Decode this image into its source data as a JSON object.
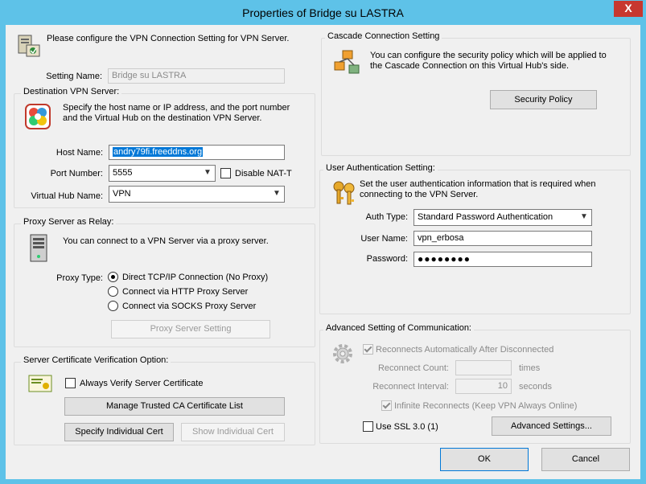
{
  "window": {
    "title": "Properties of Bridge su LASTRA",
    "close_glyph": "X"
  },
  "intro": {
    "text": "Please configure the VPN Connection Setting for VPN Server."
  },
  "setting_name": {
    "label": "Setting Name:",
    "value": "Bridge su LASTRA"
  },
  "destination": {
    "title": "Destination VPN Server:",
    "description": "Specify the host name or IP address, and the port number and the Virtual Hub on the destination VPN Server.",
    "host_label": "Host Name:",
    "host_value": "andry79fi.freeddns.org",
    "port_label": "Port Number:",
    "port_value": "5555",
    "nat_label": "Disable NAT-T",
    "hub_label": "Virtual Hub Name:",
    "hub_value": "VPN"
  },
  "proxy": {
    "title": "Proxy Server as Relay:",
    "description": "You can connect to a VPN Server via a proxy server.",
    "type_label": "Proxy Type:",
    "options": [
      "Direct TCP/IP Connection (No Proxy)",
      "Connect via HTTP Proxy Server",
      "Connect via SOCKS Proxy Server"
    ],
    "setting_button": "Proxy Server Setting"
  },
  "certificate": {
    "title": "Server Certificate Verification Option:",
    "always_verify_label": "Always Verify Server Certificate",
    "manage_button": "Manage Trusted CA Certificate List",
    "specify_button": "Specify Individual Cert",
    "show_button": "Show Individual Cert"
  },
  "cascade": {
    "title": "Cascade Connection Setting",
    "description": "You can configure the security policy which will be applied to the Cascade Connection on this Virtual Hub's side.",
    "policy_button": "Security Policy"
  },
  "auth": {
    "title": "User Authentication Setting:",
    "description": "Set the user authentication information that is required when connecting to the VPN Server.",
    "type_label": "Auth Type:",
    "type_value": "Standard Password Authentication",
    "user_label": "User Name:",
    "user_value": "vpn_erbosa",
    "password_label": "Password:",
    "password_value": "●●●●●●●●"
  },
  "advanced": {
    "title": "Advanced Setting of Communication:",
    "reconnect_label": "Reconnects Automatically After Disconnected",
    "count_label": "Reconnect Count:",
    "count_value": "",
    "count_unit": "times",
    "interval_label": "Reconnect Interval:",
    "interval_value": "10",
    "interval_unit": "seconds",
    "infinite_label": "Infinite Reconnects (Keep VPN Always Online)",
    "ssl_label": "Use SSL 3.0 (1)",
    "advanced_button": "Advanced Settings..."
  },
  "footer": {
    "ok_button": "OK",
    "cancel_button": "Cancel"
  }
}
